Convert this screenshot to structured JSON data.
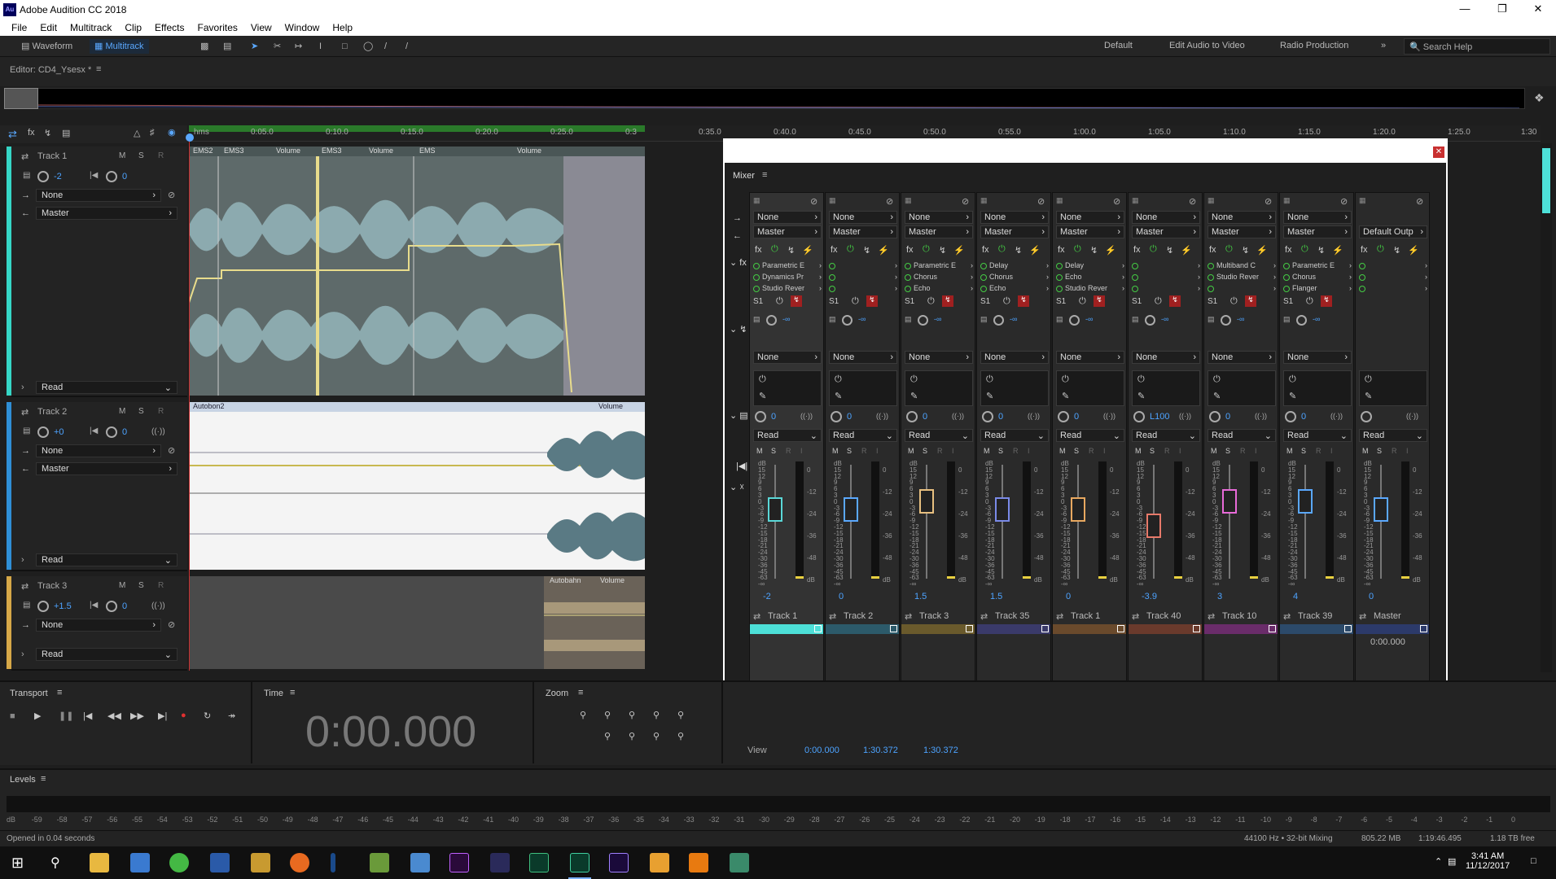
{
  "app": {
    "title": "Adobe Audition CC 2018",
    "logo": "Au"
  },
  "menu": [
    "File",
    "Edit",
    "Multitrack",
    "Clip",
    "Effects",
    "Favorites",
    "View",
    "Window",
    "Help"
  ],
  "toolbar": {
    "waveform": "Waveform",
    "multitrack": "Multitrack",
    "workspaces": [
      "Default",
      "Edit Audio to Video",
      "Radio Production"
    ],
    "search_placeholder": "Search Help"
  },
  "editor": {
    "label": "Editor: CD4_Ysesx *"
  },
  "ruler": {
    "ticks": [
      "hms",
      "0:05.0",
      "0:10.0",
      "0:15.0",
      "0:20.0",
      "0:25.0",
      "0:3",
      "0:35.0",
      "0:40.0",
      "0:45.0",
      "0:50.0",
      "0:55.0",
      "1:00.0",
      "1:05.0",
      "1:10.0",
      "1:15.0",
      "1:20.0",
      "1:25.0",
      "1:30"
    ]
  },
  "tracks": [
    {
      "name": "Track 1",
      "vol": "-2",
      "pan": "0",
      "input": "None",
      "output": "Master",
      "mode": "Read",
      "color": "#36d6c6",
      "clips": [
        "EMS2",
        "EMS3",
        "Volume",
        "EMS3",
        "Volume",
        "EMS",
        "Volume"
      ]
    },
    {
      "name": "Track 2",
      "vol": "+0",
      "pan": "0",
      "input": "None",
      "output": "Master",
      "mode": "Read",
      "color": "#2f8fd6",
      "clips": [
        "Autobon2",
        "Volume"
      ]
    },
    {
      "name": "Track 3",
      "vol": "+1.5",
      "pan": "0",
      "input": "None",
      "mode": "Read",
      "color": "#d6a848",
      "clips": [
        "Autobahn",
        "Volume"
      ]
    }
  ],
  "mixer": {
    "label": "Mixer",
    "default_output": "Default Outp",
    "strips": [
      {
        "name": "Track 1",
        "input": "None",
        "output": "Master",
        "fx": [
          "Parametric E",
          "Dynamics Pr",
          "Studio Rever"
        ],
        "send": "None",
        "pan": "0",
        "mode": "Read",
        "vol": "-2",
        "color": "#4de0d8"
      },
      {
        "name": "Track 2",
        "input": "None",
        "output": "Master",
        "fx": [
          "",
          "",
          ""
        ],
        "send": "None",
        "pan": "0",
        "mode": "Read",
        "vol": "0",
        "color": "#2c5a6a"
      },
      {
        "name": "Track 3",
        "input": "None",
        "output": "Master",
        "fx": [
          "Parametric E",
          "Chorus",
          "Echo"
        ],
        "send": "None",
        "pan": "0",
        "mode": "Read",
        "vol": "1.5",
        "color": "#6a5a2c"
      },
      {
        "name": "Track 35",
        "input": "None",
        "output": "Master",
        "fx": [
          "Delay",
          "Chorus",
          "Echo"
        ],
        "send": "None",
        "pan": "0",
        "mode": "Read",
        "vol": "1.5",
        "color": "#3a3a6a"
      },
      {
        "name": "Track 1",
        "input": "None",
        "output": "Master",
        "fx": [
          "Delay",
          "Echo",
          "Studio Rever"
        ],
        "send": "None",
        "pan": "0",
        "mode": "Read",
        "vol": "0",
        "color": "#6a4a2c"
      },
      {
        "name": "Track 40",
        "input": "None",
        "output": "Master",
        "fx": [
          "",
          "",
          ""
        ],
        "send": "None",
        "pan": "L100",
        "mode": "Read",
        "vol": "-3.9",
        "color": "#6a3a2c"
      },
      {
        "name": "Track 10",
        "input": "None",
        "output": "Master",
        "fx": [
          "Multiband C",
          "Studio Rever",
          ""
        ],
        "send": "None",
        "pan": "0",
        "mode": "Read",
        "vol": "3",
        "color": "#6a2c6a"
      },
      {
        "name": "Track 39",
        "input": "None",
        "output": "Master",
        "fx": [
          "Parametric E",
          "Chorus",
          "Flanger"
        ],
        "send": "None",
        "pan": "0",
        "mode": "Read",
        "vol": "4",
        "color": "#2c4a6a"
      },
      {
        "name": "Master",
        "input": "",
        "output": "Default Outp",
        "fx": [
          "",
          "",
          ""
        ],
        "send": "",
        "pan": "",
        "mode": "Read",
        "vol": "0",
        "color": "#2c3a6a"
      }
    ],
    "master_time": "0:00.000",
    "meter_scale": [
      "dB",
      "15",
      "12",
      "9",
      "6",
      "3",
      "0",
      "-3",
      "-6",
      "-9",
      "-12",
      "-15",
      "-18",
      "-21",
      "-24",
      "-30",
      "-36",
      "-45",
      "-63",
      "-∞"
    ],
    "right_scale": [
      "0",
      "-12",
      "-24",
      "-36",
      "-48",
      "dB"
    ]
  },
  "transport": {
    "label": "Transport"
  },
  "time": {
    "label": "Time",
    "value": "0:00.000"
  },
  "zoom": {
    "label": "Zoom"
  },
  "view": {
    "label": "View",
    "start": "0:00.000",
    "end": "1:30.372",
    "dur": "1:30.372"
  },
  "levels": {
    "label": "Levels",
    "scale": [
      "dB",
      "-59",
      "-58",
      "-57",
      "-56",
      "-55",
      "-54",
      "-53",
      "-52",
      "-51",
      "-50",
      "-49",
      "-48",
      "-47",
      "-46",
      "-45",
      "-44",
      "-43",
      "-42",
      "-41",
      "-40",
      "-39",
      "-38",
      "-37",
      "-36",
      "-35",
      "-34",
      "-33",
      "-32",
      "-31",
      "-30",
      "-29",
      "-28",
      "-27",
      "-26",
      "-25",
      "-24",
      "-23",
      "-22",
      "-21",
      "-20",
      "-19",
      "-18",
      "-17",
      "-16",
      "-15",
      "-14",
      "-13",
      "-12",
      "-11",
      "-10",
      "-9",
      "-8",
      "-7",
      "-6",
      "-5",
      "-4",
      "-3",
      "-2",
      "-1",
      "0"
    ]
  },
  "status": {
    "left": "Opened in 0.04 seconds",
    "sample": "44100 Hz • 32-bit Mixing",
    "mem": "805.22 MB",
    "dur": "1:19:46.495",
    "free": "1.18 TB free"
  },
  "clock": {
    "time": "3:41 AM",
    "date": "11/12/2017"
  }
}
